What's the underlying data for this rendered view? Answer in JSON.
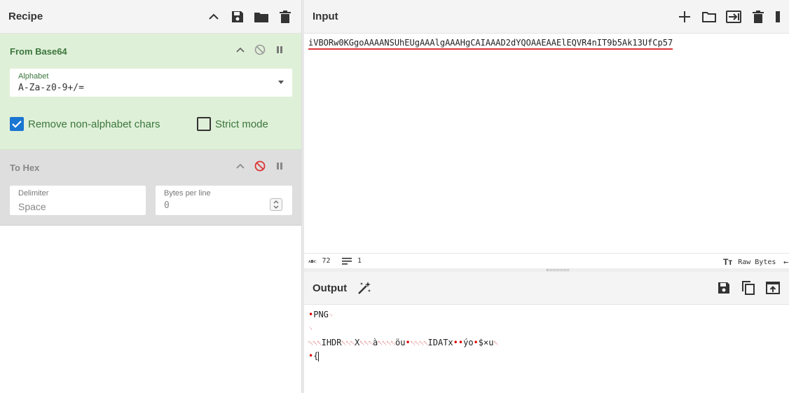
{
  "recipe": {
    "title": "Recipe"
  },
  "ops": {
    "from_base64": {
      "title": "From Base64",
      "alphabet_label": "Alphabet",
      "alphabet_value": "A-Za-z0-9+/=",
      "remove_label": "Remove non-alphabet chars",
      "strict_label": "Strict mode"
    },
    "to_hex": {
      "title": "To Hex",
      "delimiter_label": "Delimiter",
      "delimiter_value": "Space",
      "bpl_label": "Bytes per line",
      "bpl_value": "0"
    }
  },
  "input": {
    "title": "Input",
    "text": "iVBORw0KGgoAAAANSUhEUgAAAlgAAAHgCAIAAAD2dYQOAAEAAElEQVR4nIT9b5Ak13UfCp57",
    "stats": {
      "length": "72",
      "lines": "1",
      "encoding": "Raw Bytes"
    }
  },
  "output": {
    "title": "Output",
    "line1": "PNG",
    "line3_a": "IHDR",
    "line3_b": "X",
    "line3_c": "à",
    "line3_d": "öu",
    "line3_e": "IDATx",
    "line3_f": "ýo",
    "line3_g": "$×u",
    "line4": "{"
  },
  "colors": {
    "accent_green": "#3c763d",
    "op_active_bg": "#dff0d8",
    "op_disabled_bg": "#dedede",
    "checkbox_blue": "#1976d2",
    "error_red": "#d33"
  },
  "icons": [
    "chevron-up-icon",
    "save-icon",
    "folder-icon",
    "trash-icon",
    "disable-icon",
    "pause-icon",
    "plus-icon",
    "import-icon",
    "magic-wand-icon",
    "copy-icon",
    "replace-input-icon",
    "text-size-icon"
  ]
}
